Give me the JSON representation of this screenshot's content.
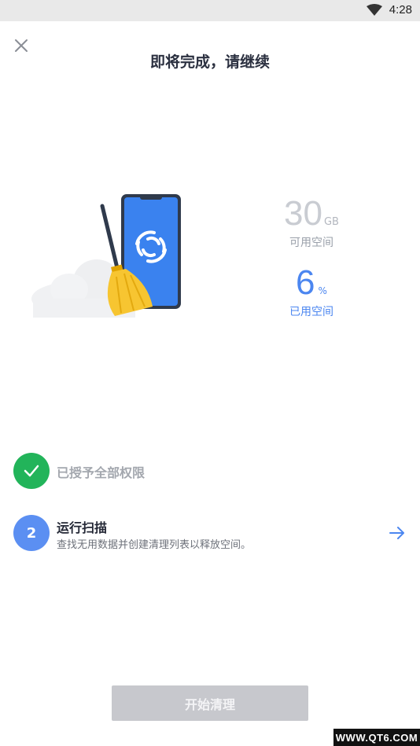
{
  "status_bar": {
    "time": "4:28",
    "wifi_icon": "wifi-icon"
  },
  "header": {
    "title": "即将完成，请继续",
    "close_icon": "close-icon"
  },
  "storage": {
    "free_value": "30",
    "free_unit": "GB",
    "free_label": "可用空间",
    "used_value": "6",
    "used_unit": "%",
    "used_label": "已用空间",
    "accent_color": "#4b86f0"
  },
  "steps": [
    {
      "badge_icon": "check-icon",
      "label": "已授予全部权限",
      "status": "done",
      "color": "#22b45a"
    },
    {
      "badge_text": "2",
      "label": "运行扫描",
      "description": "查找无用数据并创建清理列表以释放空间。",
      "arrow_icon": "arrow-right-icon"
    }
  ],
  "actions": {
    "start_label": "开始清理"
  },
  "watermark": {
    "text": "WWW.QT6.COM"
  }
}
